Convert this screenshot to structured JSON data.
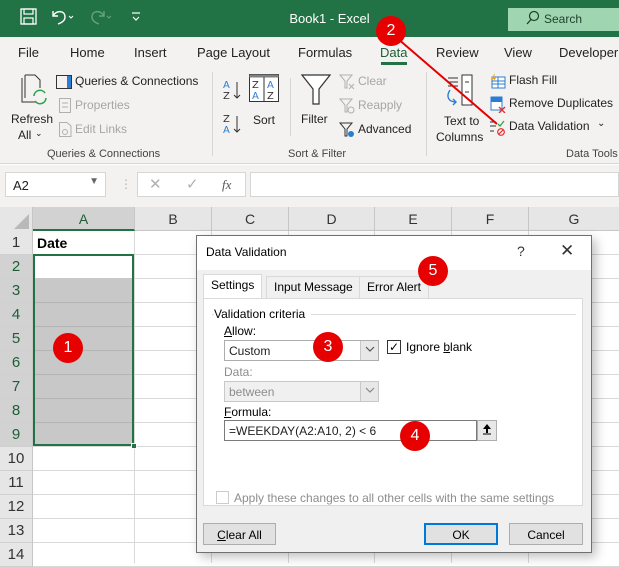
{
  "titlebar": {
    "title": "Book1  -  Excel",
    "search_label": "Search",
    "quick_access": [
      "save-icon",
      "undo-icon",
      "redo-icon",
      "customize-icon"
    ]
  },
  "tabs": [
    {
      "label": "File"
    },
    {
      "label": "Home"
    },
    {
      "label": "Insert"
    },
    {
      "label": "Page Layout"
    },
    {
      "label": "Formulas"
    },
    {
      "label": "Data",
      "active": true
    },
    {
      "label": "Review"
    },
    {
      "label": "View"
    },
    {
      "label": "Developer"
    }
  ],
  "ribbon": {
    "queries": {
      "refresh_label1": "Refresh",
      "refresh_label2": "All",
      "queries_connections": "Queries & Connections",
      "properties": "Properties",
      "edit_links": "Edit Links",
      "group_label": "Queries & Connections"
    },
    "sort_filter": {
      "sort": "Sort",
      "filter": "Filter",
      "clear": "Clear",
      "reapply": "Reapply",
      "advanced": "Advanced",
      "group_label": "Sort & Filter"
    },
    "data_tools": {
      "text_to_columns1": "Text to",
      "text_to_columns2": "Columns",
      "flash_fill": "Flash Fill",
      "remove_duplicates": "Remove Duplicates",
      "data_validation": "Data Validation",
      "group_label": "Data Tools"
    }
  },
  "formula_bar": {
    "name_box": "A2",
    "fx": "fx",
    "value": ""
  },
  "grid": {
    "columns": [
      "A",
      "B",
      "C",
      "D",
      "E",
      "F",
      "G"
    ],
    "rows": [
      "1",
      "2",
      "3",
      "4",
      "5",
      "6",
      "7",
      "8",
      "9",
      "10",
      "11",
      "12",
      "13",
      "14"
    ],
    "cells": {
      "A1": "Date"
    },
    "selection": "A2:A9"
  },
  "dialog": {
    "title": "Data Validation",
    "help": "?",
    "close": "✕",
    "tabs": [
      "Settings",
      "Input Message",
      "Error Alert"
    ],
    "active_tab": "Settings",
    "section_label": "Validation criteria",
    "allow_label": "Allow:",
    "allow_value": "Custom",
    "ignore_blank_label": "Ignore blank",
    "ignore_blank_checked": true,
    "data_label": "Data:",
    "data_value": "between",
    "formula_label": "Formula:",
    "formula_value": "=WEEKDAY(A2:A10, 2) < 6",
    "apply_label": "Apply these changes to all other cells with the same settings",
    "apply_checked": false,
    "clear_all": "Clear All",
    "ok": "OK",
    "cancel": "Cancel"
  },
  "annotations": [
    "1",
    "2",
    "3",
    "4",
    "5"
  ],
  "colors": {
    "excel_green": "#217346",
    "badge_red": "#e60000",
    "default_button_border": "#0078d7"
  }
}
